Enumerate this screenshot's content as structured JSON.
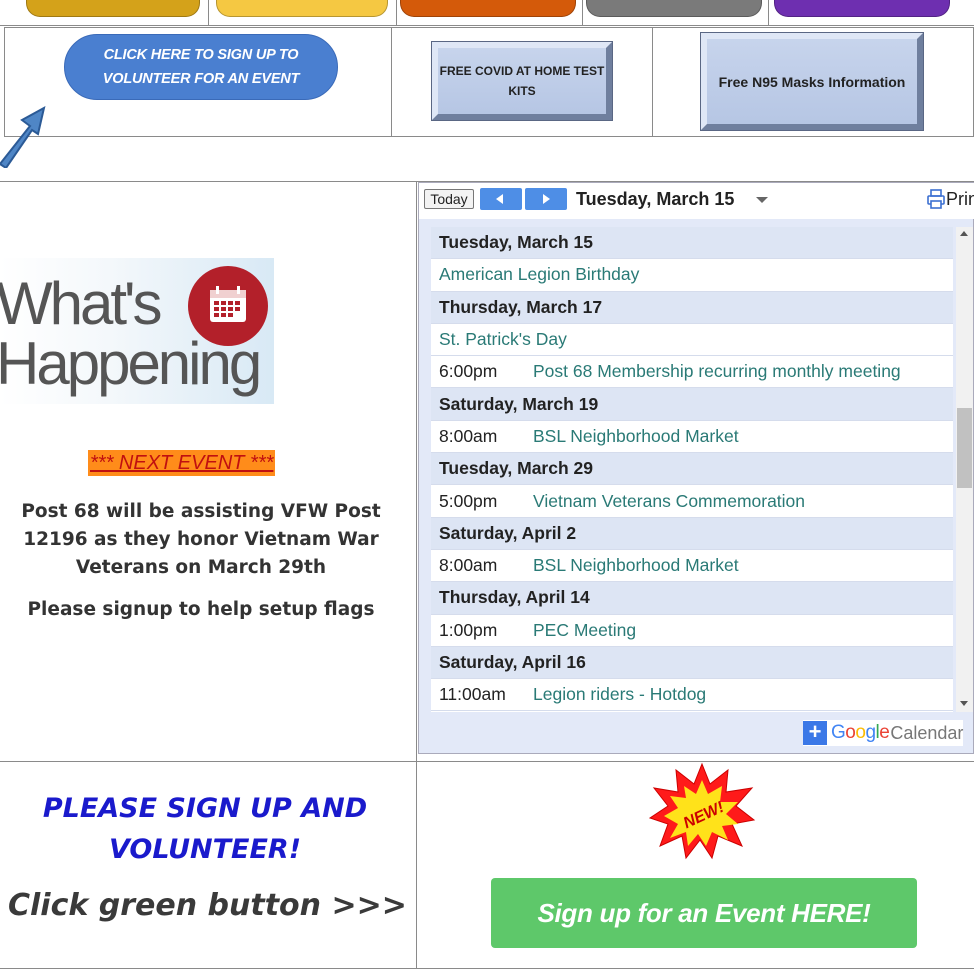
{
  "top_buttons": {
    "volunteer": "CLICK HERE TO SIGN UP TO VOLUNTEER FOR AN EVENT",
    "covid_kits": "FREE COVID AT HOME TEST KITS",
    "n95": "Free N95 Masks Information",
    "pill_colors": [
      "#d4a21a",
      "#f5c842",
      "#d45a0a",
      "#7a7a7a",
      "#6e2fb0"
    ]
  },
  "left_panel": {
    "whats": "What's",
    "happening": "Happening",
    "next_event": "*** NEXT EVENT ***",
    "assist_text": "Post 68 will be assisting VFW Post 12196 as they honor Vietnam War Veterans on March 29th",
    "signup_flags": "Please signup to help setup flags"
  },
  "calendar": {
    "today_label": "Today",
    "current_date": "Tuesday, March 15",
    "print_label": "Print",
    "google_label": "Google",
    "calendar_label": "Calendar",
    "agenda": [
      {
        "type": "date",
        "text": "Tuesday, March 15"
      },
      {
        "type": "allday",
        "text": "American Legion Birthday"
      },
      {
        "type": "date",
        "text": "Thursday, March 17"
      },
      {
        "type": "allday",
        "text": "St. Patrick's Day"
      },
      {
        "type": "timed",
        "time": "6:00pm",
        "text": "Post 68 Membership recurring monthly meeting"
      },
      {
        "type": "date",
        "text": "Saturday, March 19"
      },
      {
        "type": "timed",
        "time": "8:00am",
        "text": "BSL Neighborhood Market"
      },
      {
        "type": "date",
        "text": "Tuesday, March 29"
      },
      {
        "type": "timed",
        "time": "5:00pm",
        "text": "Vietnam Veterans Commemoration"
      },
      {
        "type": "date",
        "text": "Saturday, April 2"
      },
      {
        "type": "timed",
        "time": "8:00am",
        "text": "BSL Neighborhood Market"
      },
      {
        "type": "date",
        "text": "Thursday, April 14"
      },
      {
        "type": "timed",
        "time": "1:00pm",
        "text": "PEC Meeting"
      },
      {
        "type": "date",
        "text": "Saturday, April 16"
      },
      {
        "type": "timed",
        "time": "11:00am",
        "text": "Legion riders - Hotdog"
      }
    ]
  },
  "bottom": {
    "please_signup": "PLEASE SIGN UP AND VOLUNTEER!",
    "click_green": "Click green button >>>",
    "new_badge": "NEW!",
    "signup_button": "Sign up for an Event HERE!"
  }
}
